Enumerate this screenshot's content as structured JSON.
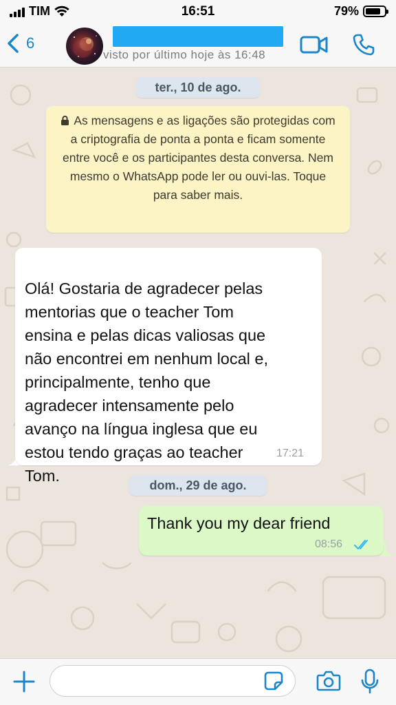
{
  "status_bar": {
    "carrier": "TIM",
    "time": "16:51",
    "battery_percent": "79%",
    "battery_level": 0.79
  },
  "header": {
    "back_count": "6",
    "last_seen": "visto por último hoje às 16:48",
    "accent_color": "#1A85C9",
    "icons": [
      "chevron-left-icon",
      "video-camera-icon",
      "phone-icon"
    ]
  },
  "chat": {
    "date_1": "ter., 10 de ago.",
    "encryption_notice": "As mensagens e as ligações são protegidas com a criptografia de ponta a ponta e ficam somente entre você e os participantes desta conversa. Nem mesmo o WhatsApp pode ler ou ouvi-las. Toque para saber mais.",
    "incoming_message": {
      "text": "Olá! Gostaria de agradecer pelas\nmentorias que o teacher Tom\nensina e pelas dicas valiosas que\nnão  encontrei em nenhum local e,\nprincipalmente, tenho que\nagradecer intensamente pelo\navanço na língua inglesa que eu\nestou tendo graças ao teacher\nTom.",
      "time": "17:21"
    },
    "date_2": "dom., 29 de ago.",
    "outgoing_message": {
      "text": "Thank you my dear friend",
      "time": "08:56",
      "status": "read"
    },
    "colors": {
      "outgoing_bubble": "#DCF8C6",
      "incoming_bubble": "#FFFFFF",
      "notice_bubble": "#FDF4C5",
      "read_ticks": "#34B7F1"
    }
  },
  "input_bar": {
    "placeholder": "",
    "icons": [
      "plus-icon",
      "sticker-icon",
      "camera-icon",
      "microphone-icon"
    ]
  }
}
